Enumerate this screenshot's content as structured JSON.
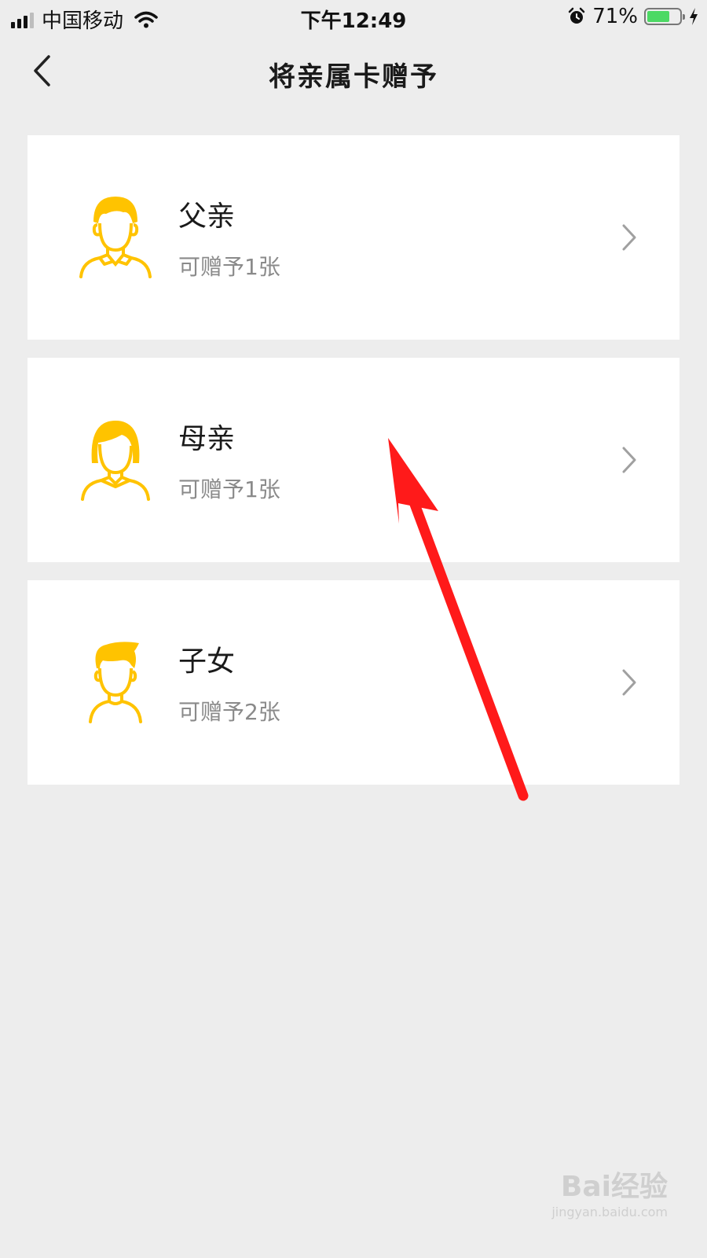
{
  "status_bar": {
    "carrier": "中国移动",
    "time": "下午12:49",
    "battery": "71%",
    "battery_level": 0.71
  },
  "nav": {
    "title": "将亲属卡赠予",
    "back_icon": "chevron-left-icon"
  },
  "items": [
    {
      "name": "父亲",
      "sub": "可赠予1张",
      "icon": "father-avatar-icon"
    },
    {
      "name": "母亲",
      "sub": "可赠予1张",
      "icon": "mother-avatar-icon"
    },
    {
      "name": "子女",
      "sub": "可赠予2张",
      "icon": "child-avatar-icon"
    }
  ],
  "colors": {
    "accent": "#FFC300",
    "background": "#EDEDED",
    "card": "#FFFFFF",
    "annotation_arrow": "#FF1A1A"
  },
  "watermark": {
    "brand": "Bai经验",
    "url": "jingyan.baidu.com"
  }
}
